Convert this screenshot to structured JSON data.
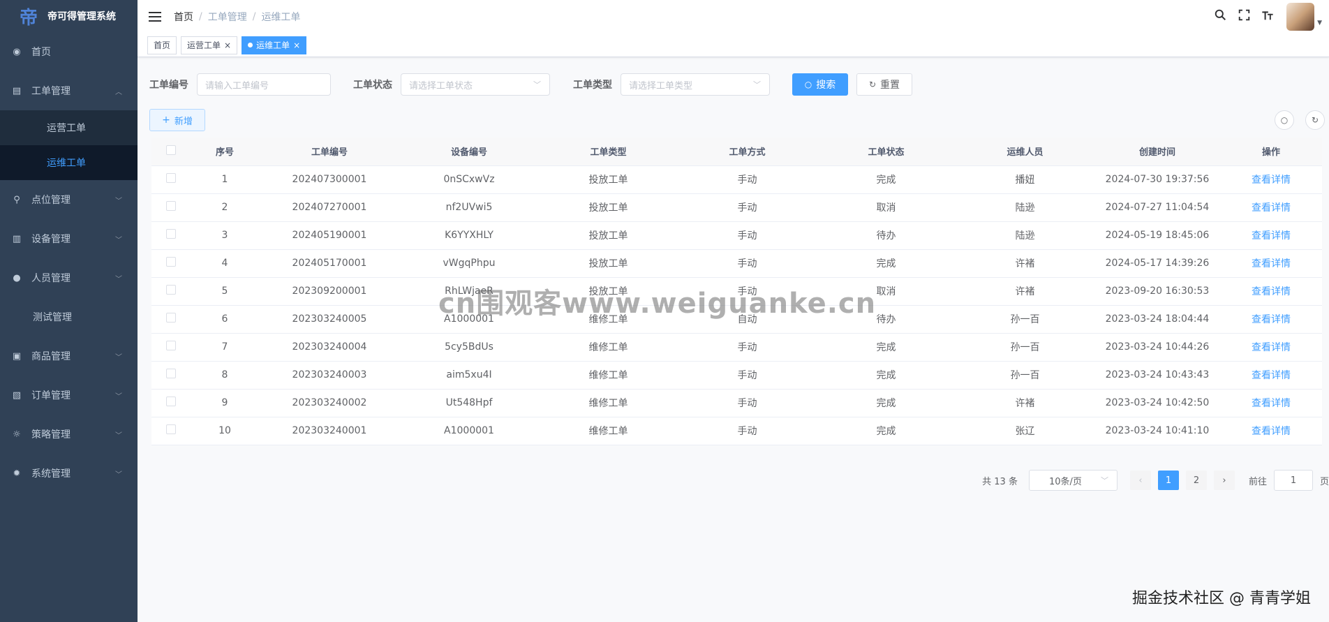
{
  "app": {
    "title": "帝可得管理系统",
    "logo_glyph": "帝"
  },
  "sidebar": {
    "items": [
      {
        "label": "首页",
        "icon": "dashboard-icon"
      },
      {
        "label": "工单管理",
        "icon": "clipboard-icon",
        "expanded": true,
        "children": [
          {
            "label": "运营工单",
            "active": false
          },
          {
            "label": "运维工单",
            "active": true
          }
        ]
      },
      {
        "label": "点位管理",
        "icon": "location-icon"
      },
      {
        "label": "设备管理",
        "icon": "device-icon"
      },
      {
        "label": "人员管理",
        "icon": "people-icon"
      },
      {
        "label": "测试管理",
        "icon": ""
      },
      {
        "label": "商品管理",
        "icon": "shopping-icon"
      },
      {
        "label": "订单管理",
        "icon": "order-icon"
      },
      {
        "label": "策略管理",
        "icon": "bulb-icon"
      },
      {
        "label": "系统管理",
        "icon": "gear-icon"
      }
    ]
  },
  "navbar": {
    "breadcrumb": [
      "首页",
      "工单管理",
      "运维工单"
    ],
    "breadcrumb_separator": "/"
  },
  "tags": [
    {
      "label": "首页",
      "closable": false,
      "active": false
    },
    {
      "label": "运营工单",
      "closable": true,
      "active": false
    },
    {
      "label": "运维工单",
      "closable": true,
      "active": true
    }
  ],
  "search": {
    "task_code_label": "工单编号",
    "task_code_placeholder": "请输入工单编号",
    "status_label": "工单状态",
    "status_placeholder": "请选择工单状态",
    "type_label": "工单类型",
    "type_placeholder": "请选择工单类型",
    "search_button": "搜索",
    "reset_button": "重置"
  },
  "toolbar": {
    "add_button": "新增"
  },
  "table": {
    "columns": [
      "序号",
      "工单编号",
      "设备编号",
      "工单类型",
      "工单方式",
      "工单状态",
      "运维人员",
      "创建时间",
      "操作"
    ],
    "rows": [
      [
        "1",
        "202407300001",
        "0nSCxwVz",
        "投放工单",
        "手动",
        "完成",
        "播妞",
        "2024-07-30 19:37:56",
        "查看详情"
      ],
      [
        "2",
        "202407270001",
        "nf2UVwi5",
        "投放工单",
        "手动",
        "取消",
        "陆逊",
        "2024-07-27 11:04:54",
        "查看详情"
      ],
      [
        "3",
        "202405190001",
        "K6YYXHLY",
        "投放工单",
        "手动",
        "待办",
        "陆逊",
        "2024-05-19 18:45:06",
        "查看详情"
      ],
      [
        "4",
        "202405170001",
        "vWgqPhpu",
        "投放工单",
        "手动",
        "完成",
        "许褚",
        "2024-05-17 14:39:26",
        "查看详情"
      ],
      [
        "5",
        "202309200001",
        "RhLWjaeR",
        "投放工单",
        "手动",
        "取消",
        "许褚",
        "2023-09-20 16:30:53",
        "查看详情"
      ],
      [
        "6",
        "202303240005",
        "A1000001",
        "维修工单",
        "自动",
        "待办",
        "孙一百",
        "2023-03-24 18:04:44",
        "查看详情"
      ],
      [
        "7",
        "202303240004",
        "5cy5BdUs",
        "维修工单",
        "手动",
        "完成",
        "孙一百",
        "2023-03-24 10:44:26",
        "查看详情"
      ],
      [
        "8",
        "202303240003",
        "aim5xu4I",
        "维修工单",
        "手动",
        "完成",
        "孙一百",
        "2023-03-24 10:43:43",
        "查看详情"
      ],
      [
        "9",
        "202303240002",
        "Ut548Hpf",
        "维修工单",
        "手动",
        "完成",
        "许褚",
        "2023-03-24 10:42:50",
        "查看详情"
      ],
      [
        "10",
        "202303240001",
        "A1000001",
        "维修工单",
        "手动",
        "完成",
        "张辽",
        "2023-03-24 10:41:10",
        "查看详情"
      ]
    ]
  },
  "pagination": {
    "total_text": "共 13 条",
    "page_size": "10条/页",
    "pages": [
      "1",
      "2"
    ],
    "current_page": "1",
    "goto_prefix": "前往",
    "goto_value": "1",
    "goto_suffix": "页"
  },
  "overlay": {
    "watermark": "cn围观客www.weiguanke.cn",
    "footer": "掘金技术社区 @ 青青学姐"
  },
  "colors": {
    "sidebar_bg": "#304156",
    "primary": "#409eff",
    "submenu_bg": "#1f2d3d"
  }
}
